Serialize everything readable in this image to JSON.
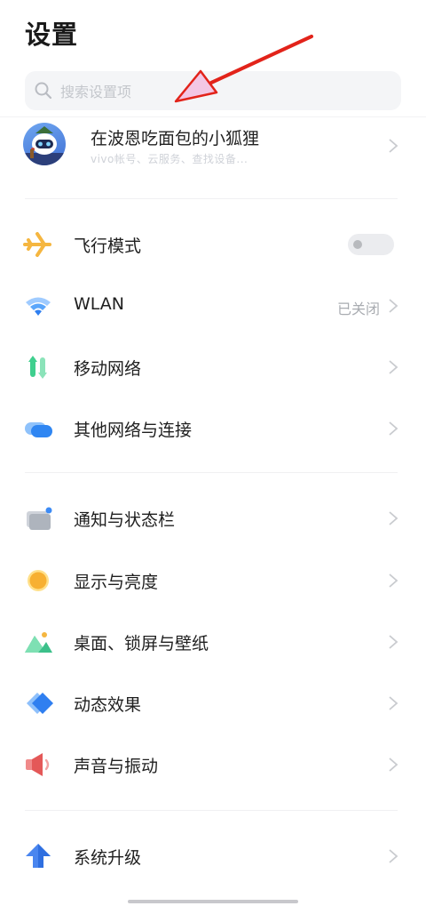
{
  "header": {
    "title": "设置"
  },
  "search": {
    "placeholder": "搜索设置项"
  },
  "profile": {
    "name": "在波恩吃面包的小狐狸",
    "subtitle": "vivo帐号、云服务、查找设备..."
  },
  "groups": [
    {
      "items": [
        {
          "label": "飞行模式",
          "icon": "airplane-icon",
          "control": "toggle",
          "toggle_on": false
        },
        {
          "label": "WLAN",
          "icon": "wifi-icon",
          "value": "已关闭"
        },
        {
          "label": "移动网络",
          "icon": "mobile-data-icon"
        },
        {
          "label": "其他网络与连接",
          "icon": "connection-icon"
        }
      ]
    },
    {
      "items": [
        {
          "label": "通知与状态栏",
          "icon": "notification-icon"
        },
        {
          "label": "显示与亮度",
          "icon": "brightness-icon"
        },
        {
          "label": "桌面、锁屏与壁纸",
          "icon": "wallpaper-icon"
        },
        {
          "label": "动态效果",
          "icon": "dynamic-effect-icon"
        },
        {
          "label": "声音与振动",
          "icon": "sound-icon"
        }
      ]
    },
    {
      "items": [
        {
          "label": "系统升级",
          "icon": "system-update-icon"
        }
      ]
    }
  ],
  "colors": {
    "airplane": "#f5b640",
    "wifi": "#3d8bf5",
    "mobile_data": "#3fcf8e",
    "connection": "#2f86f2",
    "annotation_arrow": "#e2231a"
  }
}
